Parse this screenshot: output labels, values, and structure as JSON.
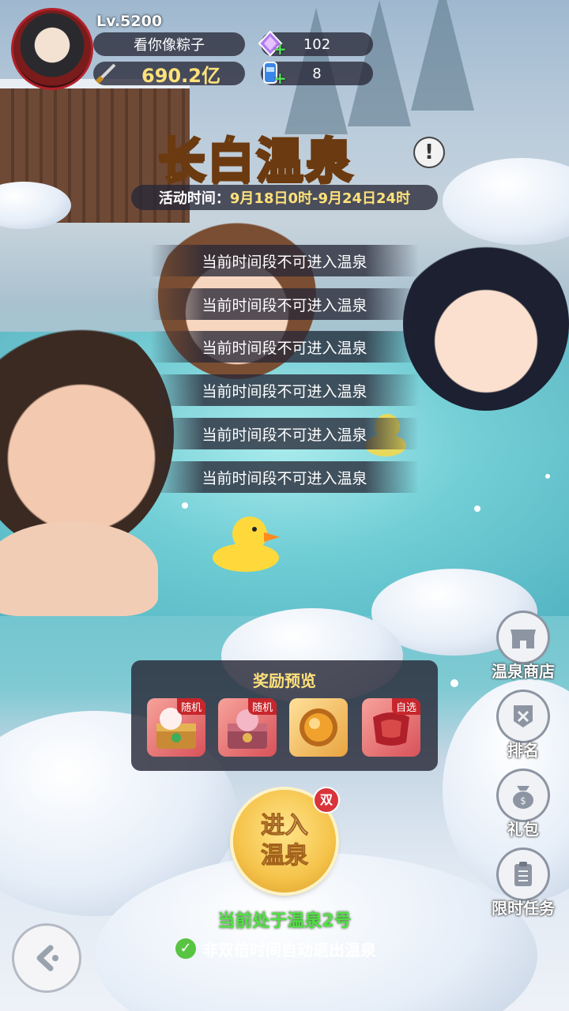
{
  "player": {
    "level": "Lv.5200",
    "name": "看你像粽子",
    "power": "690.2亿"
  },
  "currencies": [
    {
      "icon": "purple-gem-icon",
      "value": "102"
    },
    {
      "icon": "blue-can-icon",
      "value": "8"
    }
  ],
  "event": {
    "title": "长白温泉",
    "time_label": "活动时间：",
    "time_value": "9月18日0时-9月24日24时"
  },
  "notices": [
    "当前时间段不可进入温泉",
    "当前时间段不可进入温泉",
    "当前时间段不可进入温泉",
    "当前时间段不可进入温泉",
    "当前时间段不可进入温泉",
    "当前时间段不可进入温泉"
  ],
  "rewards": {
    "title": "奖励预览",
    "items": [
      {
        "icon": "fox-chest-icon",
        "tag": "随机"
      },
      {
        "icon": "pink-chest-icon",
        "tag": "随机"
      },
      {
        "icon": "golden-orb-icon",
        "tag": ""
      },
      {
        "icon": "red-cloth-icon",
        "tag": "自选"
      }
    ]
  },
  "enter": {
    "label": "进入温泉",
    "double_badge": "双"
  },
  "status": {
    "current": "当前处于温泉2号",
    "auto_exit": "非双倍时间自动退出温泉"
  },
  "side_menu": [
    {
      "icon": "shop-icon",
      "label": "温泉商店"
    },
    {
      "icon": "ranking-icon",
      "label": "排名"
    },
    {
      "icon": "gift-bag-icon",
      "label": "礼包"
    },
    {
      "icon": "task-clipboard-icon",
      "label": "限时任务"
    }
  ],
  "colors": {
    "title_gold": "#ffe27a",
    "status_green": "#52e046",
    "tag_red": "#c6262c"
  }
}
